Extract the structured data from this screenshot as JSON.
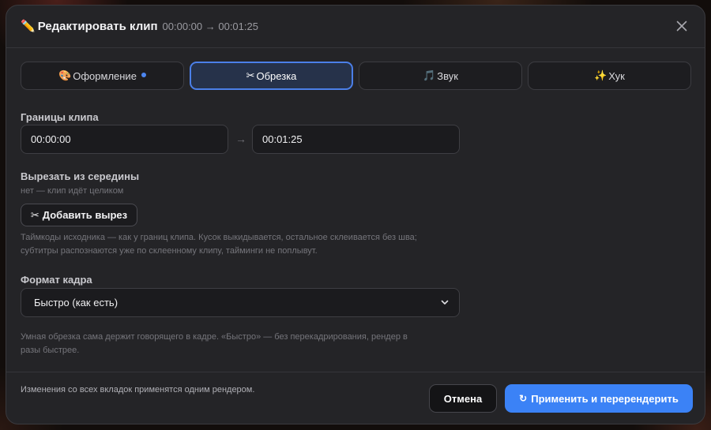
{
  "header": {
    "icon": "pencil-icon",
    "title": "Редактировать клип",
    "time_range": "00:00:00 → 00:01:25"
  },
  "tabs": [
    {
      "icon": "palette-icon",
      "glyph": "🎨",
      "label": "Оформление",
      "has_dot": true
    },
    {
      "icon": "scissors-icon",
      "glyph": "✂",
      "label": "Обрезка",
      "active": true
    },
    {
      "icon": "music-note-icon",
      "glyph": "🎵",
      "label": "Звук"
    },
    {
      "icon": "sparkles-icon",
      "glyph": "✨",
      "label": "Хук"
    }
  ],
  "bounds": {
    "label": "Границы клипа",
    "start": "00:00:00",
    "end": "00:01:25",
    "arrow": "→"
  },
  "cut": {
    "label": "Вырезать из середины",
    "status": "нет — клип идёт целиком",
    "add_glyph": "✂",
    "add_button": "Добавить вырез",
    "hint_line1": "Таймкоды исходника — как у границ клипа. Кусок выкидывается, остальное склеивается без шва;",
    "hint_line2": "субтитры распознаются уже по склеенному клипу, тайминги не поплывут."
  },
  "frame": {
    "label": "Формат кадра",
    "selected": "Быстро (как есть)",
    "hint_line1": "Умная обрезка сама держит говорящего в кадре. «Быстро» — без перекадрирования, рендер в",
    "hint_line2": "разы быстрее."
  },
  "footer": {
    "note": "Изменения со всех вкладок применятся одним рендером.",
    "cancel": "Отмена",
    "apply_glyph": "↻",
    "apply": "Применить и перерендерить"
  },
  "colors": {
    "accent": "#3b82f6",
    "modal_bg": "#242427",
    "active_tab_bg": "#26324a",
    "active_tab_border": "#4b7fe8"
  }
}
